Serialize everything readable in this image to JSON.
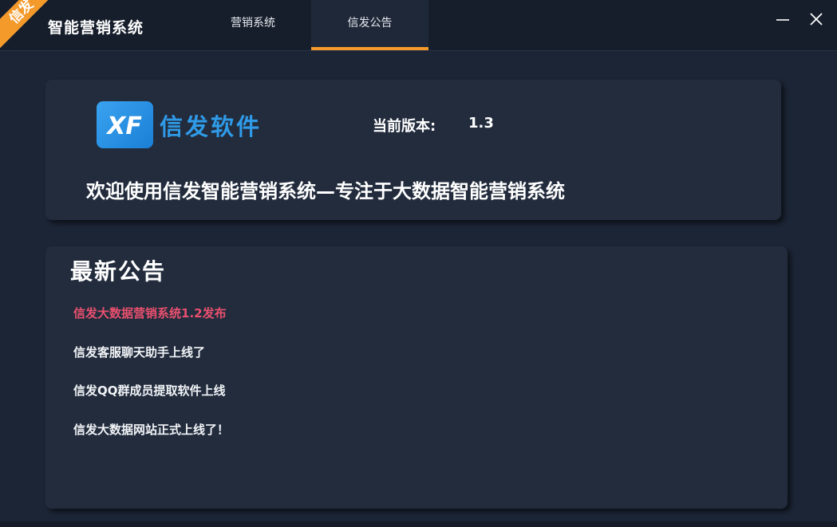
{
  "titlebar": {
    "corner_badge": "信发",
    "app_title": "智能营销系统",
    "tabs": [
      {
        "label": "营销系统"
      },
      {
        "label": "信发公告"
      }
    ],
    "accent_color": "#f39a2b"
  },
  "header_card": {
    "logo_mark": "XF",
    "logo_text": "信发软件",
    "version_label": "当前版本:",
    "version_value": "1.3",
    "welcome_text": "欢迎使用信发智能营销系统—专注于大数据智能营销系统"
  },
  "notice_card": {
    "heading": "最新公告",
    "items": [
      {
        "text": "信发大数据营销系统1.2发布",
        "highlight_color": "#e8506e"
      },
      {
        "text": "信发客服聊天助手上线了"
      },
      {
        "text": "信发QQ群成员提取软件上线"
      },
      {
        "text": "信发大数据网站正式上线了！"
      }
    ]
  },
  "icons": {
    "minimize": "minimize-icon",
    "close": "close-icon",
    "logo": "xf-logo-icon"
  }
}
